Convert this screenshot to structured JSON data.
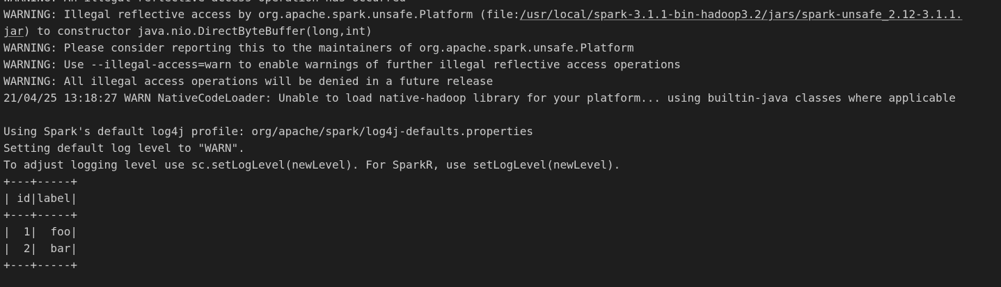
{
  "terminal": {
    "lines": [
      "WARNING: An illegal reflective access operation has occurred",
      {
        "prefix": "WARNING: Illegal reflective access by org.apache.spark.unsafe.Platform (file:",
        "link": "/usr/local/spark-3.1.1-bin-hadoop3.2/jars/spark-unsafe_2.12-3.1.1.jar",
        "suffix": ") to constructor java.nio.DirectByteBuffer(long,int)"
      },
      "WARNING: Please consider reporting this to the maintainers of org.apache.spark.unsafe.Platform",
      "WARNING: Use --illegal-access=warn to enable warnings of further illegal reflective access operations",
      "WARNING: All illegal access operations will be denied in a future release",
      "21/04/25 13:18:27 WARN NativeCodeLoader: Unable to load native-hadoop library for your platform... using builtin-java classes where applicable",
      "Using Spark's default log4j profile: org/apache/spark/log4j-defaults.properties",
      "Setting default log level to \"WARN\".",
      "To adjust logging level use sc.setLogLevel(newLevel). For SparkR, use setLogLevel(newLevel).",
      "+---+-----+",
      "| id|label|",
      "+---+-----+",
      "|  1|  foo|",
      "|  2|  bar|",
      "+---+-----+"
    ]
  },
  "colors": {
    "background": "#1e1e1e",
    "text": "#cccccc"
  }
}
